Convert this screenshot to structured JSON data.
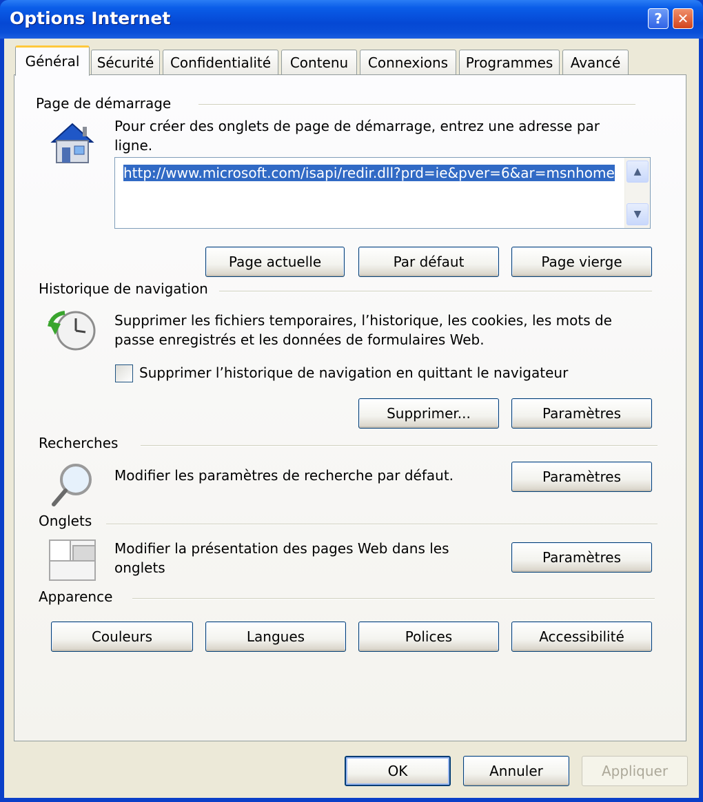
{
  "window": {
    "title": "Options Internet",
    "help_glyph": "?",
    "close_glyph": "✕"
  },
  "tabs": [
    {
      "label": "Général",
      "active": true
    },
    {
      "label": "Sécurité"
    },
    {
      "label": "Confidentialité"
    },
    {
      "label": "Contenu"
    },
    {
      "label": "Connexions"
    },
    {
      "label": "Programmes"
    },
    {
      "label": "Avancé"
    }
  ],
  "home": {
    "group_label": "Page de démarrage",
    "description": "Pour créer des onglets de page de démarrage, entrez une adresse par ligne.",
    "url_value": "http://www.microsoft.com/isapi/redir.dll?prd=ie&pver=6&ar=msnhome",
    "buttons": {
      "current": "Page actuelle",
      "default": "Par défaut",
      "blank": "Page vierge"
    },
    "icon": "house-icon"
  },
  "history": {
    "group_label": "Historique de navigation",
    "description": "Supprimer les fichiers temporaires, l’historique, les cookies, les mots de passe enregistrés et les données de formulaires Web.",
    "checkbox_label": "Supprimer l’historique de navigation en quittant le navigateur",
    "checkbox_checked": false,
    "buttons": {
      "delete": "Supprimer...",
      "settings": "Paramètres"
    },
    "icon": "clock-history-icon"
  },
  "search": {
    "group_label": "Recherches",
    "description": "Modifier les paramètres de recherche par défaut.",
    "settings_button": "Paramètres",
    "icon": "magnifier-icon"
  },
  "tabs_group": {
    "group_label": "Onglets",
    "description": "Modifier la présentation des pages Web dans les onglets",
    "settings_button": "Paramètres",
    "icon": "tabs-window-icon"
  },
  "appearance": {
    "group_label": "Apparence",
    "buttons": {
      "colors": "Couleurs",
      "languages": "Langues",
      "fonts": "Polices",
      "accessibility": "Accessibilité"
    }
  },
  "footer": {
    "ok": "OK",
    "cancel": "Annuler",
    "apply": "Appliquer"
  },
  "colors": {
    "title_bar": "#0a5de8",
    "dialog_bg": "#ece9d8",
    "selection": "#316ac5",
    "active_tab_accent": "#ffc83c"
  }
}
